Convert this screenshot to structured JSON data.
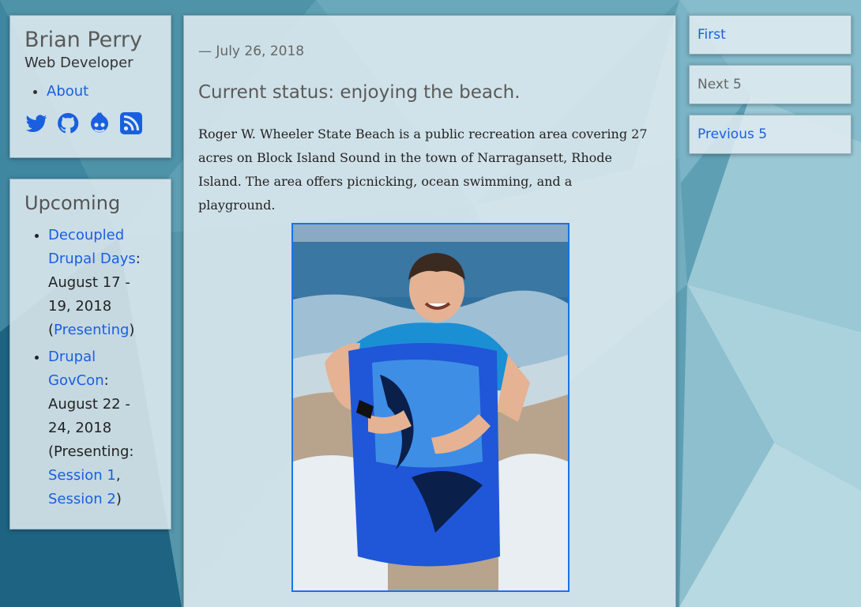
{
  "sidebar": {
    "name": "Brian Perry",
    "role": "Web Developer",
    "nav": [
      {
        "label": "About"
      }
    ],
    "social_icons": [
      "twitter-icon",
      "github-icon",
      "drupal-icon",
      "rss-icon"
    ]
  },
  "upcoming": {
    "heading": "Upcoming",
    "events": [
      {
        "link": "Decoupled Drupal Days",
        "sep": ":",
        "dates": "August 17 - 19, 2018",
        "open": "(",
        "role_link": "Presenting",
        "close": ")"
      },
      {
        "link": "Drupal GovCon",
        "sep": ":",
        "dates": "August 22 - 24, 2018",
        "open": "(Presenting:",
        "session1": "Session 1",
        "comma": ",",
        "session2": "Session 2",
        "close": ")"
      }
    ]
  },
  "article": {
    "date": "— July 26, 2018",
    "title": "Current status: enjoying the beach.",
    "body": "Roger W. Wheeler State Beach is a public recreation area covering 27 acres on Block Island Sound in the town of Narragansett, Rhode Island. The area offers picnicking, ocean swimming, and a playground."
  },
  "pager": {
    "first": "First",
    "next": "Next 5",
    "previous": "Previous 5"
  },
  "colors": {
    "link": "#1a5fe0",
    "background": "#5d9fb4",
    "image_border": "#1a73e8"
  }
}
